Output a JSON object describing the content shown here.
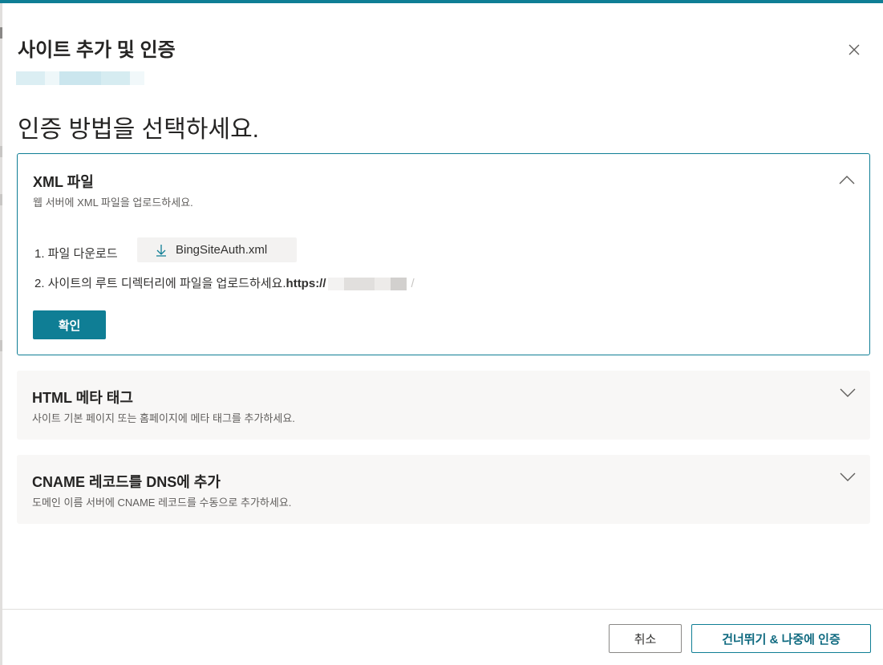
{
  "dialog": {
    "title": "사이트 추가 및 인증",
    "subtitle": "인증 방법을 선택하세요."
  },
  "methods": [
    {
      "title": "XML 파일",
      "description": "웹 서버에 XML 파일을 업로드하세요.",
      "expanded": true,
      "step1_label": "1. 파일 다운로드",
      "download_label": "BingSiteAuth.xml",
      "step2_label": "2. 사이트의 루트 디렉터리에 파일을 업로드하세요.",
      "step2_url": "https://",
      "step2_url_end": "/",
      "confirm_label": "확인"
    },
    {
      "title": "HTML 메타 태그",
      "description": "사이트 기본 페이지 또는 홈페이지에 메타 태그를 추가하세요.",
      "expanded": false
    },
    {
      "title": "CNAME 레코드를 DNS에 추가",
      "description": "도메인 이름 서버에 CNAME 레코드를 수동으로 추가하세요.",
      "expanded": false
    }
  ],
  "footer": {
    "cancel_label": "취소",
    "skip_label": "건너뛰기 & 나중에 인증"
  },
  "colors": {
    "accent": "#0f7e95",
    "card_bg": "#f8f7f6"
  },
  "icons": {
    "close": "close-icon",
    "download": "download-icon",
    "expand": "chevron-down-icon",
    "collapse": "chevron-up-icon"
  }
}
